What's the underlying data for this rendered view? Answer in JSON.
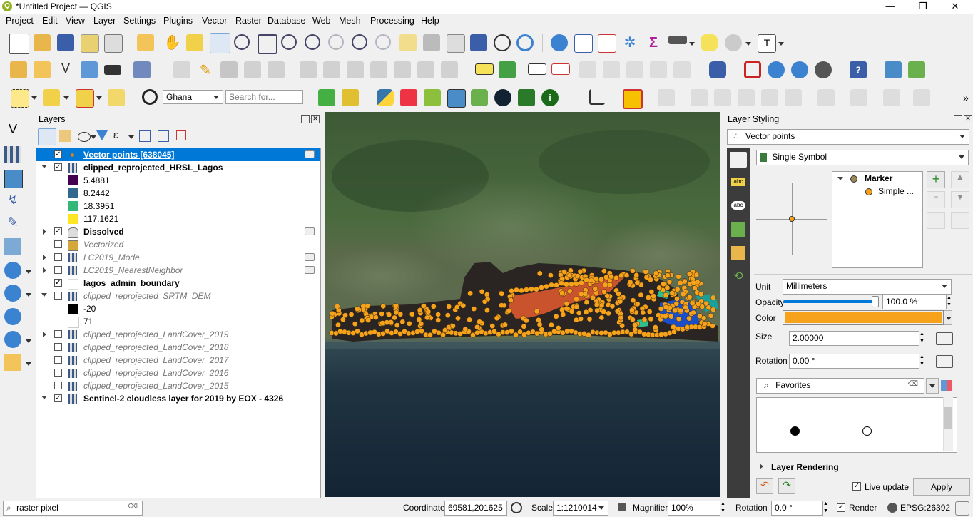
{
  "window": {
    "title": "*Untitled Project — QGIS",
    "logo_letter": "Q",
    "min": "—",
    "max": "❐",
    "close": "✕"
  },
  "menu": [
    "Project",
    "Edit",
    "View",
    "Layer",
    "Settings",
    "Plugins",
    "Vector",
    "Raster",
    "Database",
    "Web",
    "Mesh",
    "Processing",
    "Help"
  ],
  "toolbar": {
    "locator_combo": "Ghana",
    "search_placeholder": "Search for...",
    "overflow": "»"
  },
  "layers_panel": {
    "title": "Layers",
    "rows": [
      {
        "name": "Vector points [638045]",
        "checked": true,
        "selected": true,
        "style": "ul",
        "icon": "point"
      },
      {
        "name": "clipped_reprojected_HRSL_Lagos",
        "checked": true,
        "style": "b",
        "icon": "raster",
        "expand": "open"
      },
      {
        "name": "5.4881",
        "legend": true,
        "color": "#440154"
      },
      {
        "name": "8.2442",
        "legend": true,
        "color": "#31688e"
      },
      {
        "name": "18.3951",
        "legend": true,
        "color": "#35b779"
      },
      {
        "name": "117.1621",
        "legend": true,
        "color": "#fde725"
      },
      {
        "name": "Dissolved",
        "checked": true,
        "style": "b",
        "icon": "poly",
        "expand": "closed"
      },
      {
        "name": "Vectorized",
        "checked": false,
        "style": "i",
        "icon": "fill"
      },
      {
        "name": "LC2019_Mode",
        "checked": false,
        "style": "i",
        "icon": "raster",
        "expand": "closed"
      },
      {
        "name": "LC2019_NearestNeighbor",
        "checked": false,
        "style": "i",
        "icon": "raster",
        "expand": "closed"
      },
      {
        "name": "lagos_admin_boundary",
        "checked": true,
        "style": "b",
        "icon": "outline"
      },
      {
        "name": "clipped_reprojected_SRTM_DEM",
        "checked": false,
        "style": "i",
        "icon": "raster",
        "expand": "open"
      },
      {
        "name": "-20",
        "legend": true,
        "color": "#000000"
      },
      {
        "name": "71",
        "legend": true,
        "color": "#ffffff"
      },
      {
        "name": "clipped_reprojected_LandCover_2019",
        "checked": false,
        "style": "i",
        "icon": "raster",
        "expand": "closed"
      },
      {
        "name": "clipped_reprojected_LandCover_2018",
        "checked": false,
        "style": "i",
        "icon": "raster"
      },
      {
        "name": "clipped_reprojected_LandCover_2017",
        "checked": false,
        "style": "i",
        "icon": "raster"
      },
      {
        "name": "clipped_reprojected_LandCover_2016",
        "checked": false,
        "style": "i",
        "icon": "raster"
      },
      {
        "name": "clipped_reprojected_LandCover_2015",
        "checked": false,
        "style": "i",
        "icon": "raster"
      },
      {
        "name": "Sentinel-2 cloudless layer for 2019 by EOX - 4326",
        "checked": true,
        "style": "b",
        "icon": "raster",
        "expand": "open"
      }
    ]
  },
  "styling_panel": {
    "title": "Layer Styling",
    "layer_combo": "Vector points",
    "renderer": "Single Symbol",
    "tree_marker": "Marker",
    "tree_simple": "Simple ...",
    "unit_label": "Unit",
    "unit_value": "Millimeters",
    "opacity_label": "Opacity",
    "opacity_value": "100.0 %",
    "opacity_fraction": 1.0,
    "color_label": "Color",
    "color_value": "#f7a21b",
    "size_label": "Size",
    "size_value": "2.00000",
    "rotation_label": "Rotation",
    "rotation_value": "0.00 °",
    "favorites": "Favorites",
    "layer_rendering": "Layer Rendering",
    "live_update": "Live update",
    "apply": "Apply"
  },
  "status": {
    "search_value": "raster pixel",
    "coordinate_label": "Coordinate",
    "coordinate_value": "69581,201625",
    "scale_label": "Scale",
    "scale_value": "1:1210014",
    "magnifier_label": "Magnifier",
    "magnifier_value": "100%",
    "rotation_label": "Rotation",
    "rotation_value": "0.0 °",
    "render_label": "Render",
    "crs": "EPSG:26392"
  },
  "colors": {
    "selection": "#0078d7",
    "point_orange": "#f7a21b",
    "qgis_green": "#93b023"
  }
}
